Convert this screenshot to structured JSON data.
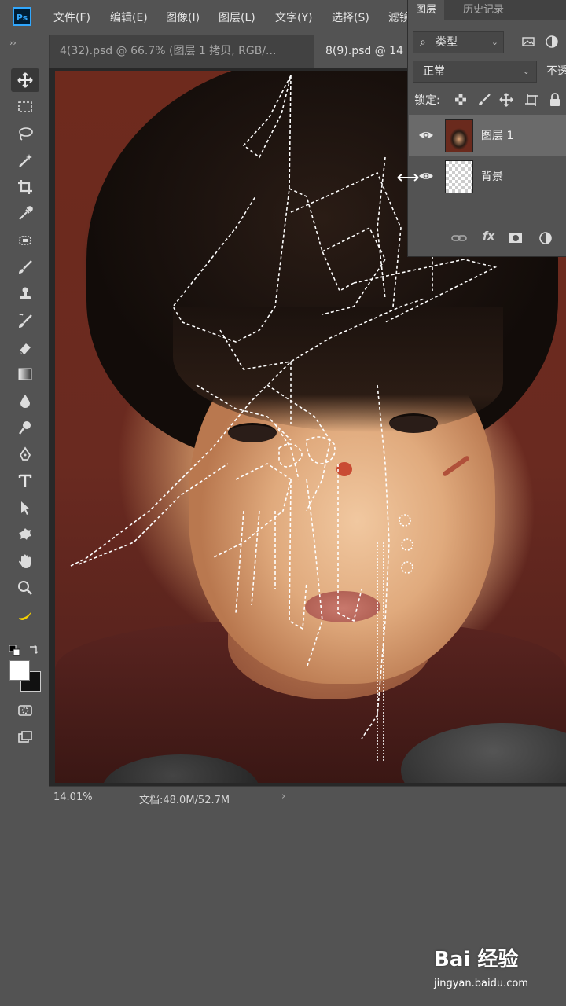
{
  "app": {
    "logo": "Ps"
  },
  "menu": [
    "文件(F)",
    "编辑(E)",
    "图像(I)",
    "图层(L)",
    "文字(Y)",
    "选择(S)",
    "滤镜"
  ],
  "tabs": [
    {
      "label": "4(32).psd @ 66.7% (图层 1 拷贝, RGB/..."
    },
    {
      "label": "8(9).psd @ 14"
    }
  ],
  "tab_close": "×",
  "toolbar": {
    "collapse": "››",
    "tools": [
      "move-tool",
      "marquee-tool",
      "lasso-tool",
      "magic-wand-tool",
      "crop-tool",
      "eyedropper-tool",
      "healing-brush-tool",
      "brush-tool",
      "clone-stamp-tool",
      "history-brush-tool",
      "eraser-tool",
      "gradient-tool",
      "blur-tool",
      "dodge-tool",
      "pen-tool",
      "type-tool",
      "path-selection-tool",
      "custom-shape-tool",
      "hand-tool",
      "zoom-tool",
      "banana-tool"
    ],
    "active_tool": "move-tool"
  },
  "status": {
    "zoom": "14.01%",
    "doc": "文档:48.0M/52.7M",
    "chevron": "›"
  },
  "layers_panel": {
    "tabs": [
      "图层",
      "历史记录"
    ],
    "filter": {
      "search_icon": "⌕",
      "label": "类型",
      "dropdown": "⌄"
    },
    "blend_mode": "正常",
    "blend_dropdown": "⌄",
    "opacity_label": "不透",
    "lock_label": "锁定:",
    "layers": [
      {
        "name": "图层 1",
        "visible": true,
        "selected": true
      },
      {
        "name": "背景",
        "visible": true,
        "selected": false
      }
    ],
    "bottom_icons": [
      "link-icon",
      "fx-icon",
      "mask-icon",
      "adjustment-icon"
    ],
    "fx_label": "fx"
  },
  "watermark": {
    "logo": "Bai 经验",
    "url": "jingyan.baidu.com"
  },
  "colors": {
    "accent": "#31a8ff",
    "panel": "#535353",
    "dark": "#424242"
  }
}
